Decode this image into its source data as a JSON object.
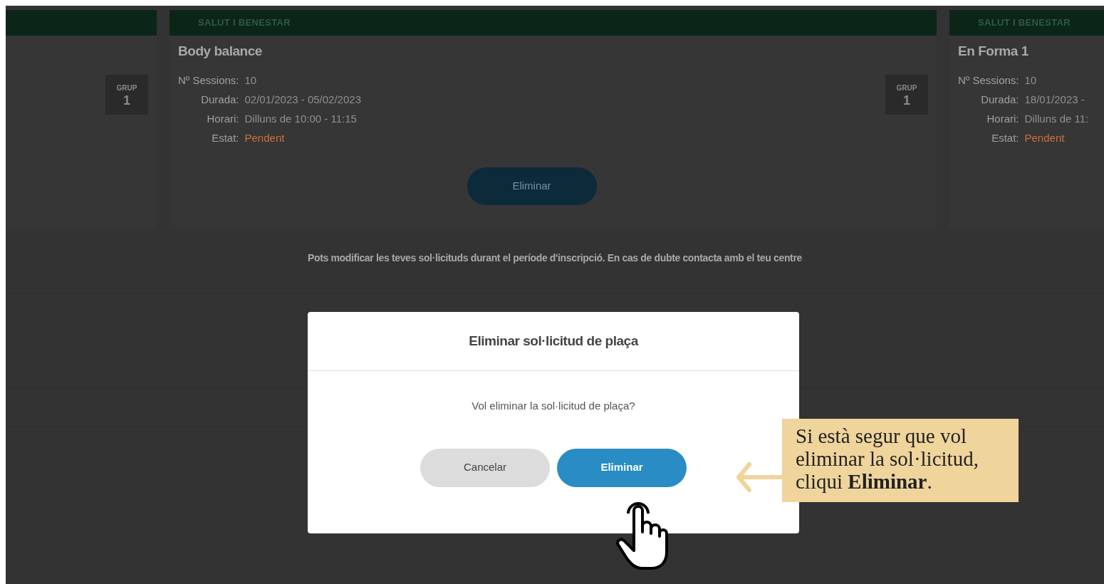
{
  "cards": [
    {
      "grup": {
        "label": "GRUP",
        "number": "1"
      }
    },
    {
      "category": "SALUT I BENESTAR",
      "title": "Body balance",
      "fields": [
        {
          "label": "Nº Sessions:",
          "value": "10",
          "kind": "text"
        },
        {
          "label": "Durada:",
          "value": "02/01/2023 - 05/02/2023",
          "kind": "text"
        },
        {
          "label": "Horari:",
          "value": "Dilluns de 10:00 - 11:15",
          "kind": "text"
        },
        {
          "label": "Estat:",
          "value": "Pendent",
          "kind": "status"
        }
      ],
      "grup": {
        "label": "GRUP",
        "number": "1"
      },
      "button": "Eliminar"
    },
    {
      "category": "SALUT I BENESTAR",
      "title": "En Forma 1",
      "fields": [
        {
          "label": "Nº Sessions:",
          "value": "10",
          "kind": "text"
        },
        {
          "label": "Durada:",
          "value": "18/01/2023 -",
          "kind": "text"
        },
        {
          "label": "Horari:",
          "value": "Dilluns de 11:",
          "kind": "text"
        },
        {
          "label": "Estat:",
          "value": "Pendent",
          "kind": "status"
        }
      ]
    }
  ],
  "notice": "Pots modificar les teves sol·licituds durant el període d'inscripció. En cas de dubte contacta amb el teu centre",
  "modal": {
    "title": "Eliminar sol·licitud de plaça",
    "message": "Vol eliminar la sol·licitud de plaça?",
    "buttons": [
      {
        "label": "Cancelar",
        "kind": "secondary"
      },
      {
        "label": "Eliminar",
        "kind": "primary"
      }
    ]
  },
  "callout": "Si està segur que vol eliminar la sol·licitud, cliqui **Eliminar**."
}
